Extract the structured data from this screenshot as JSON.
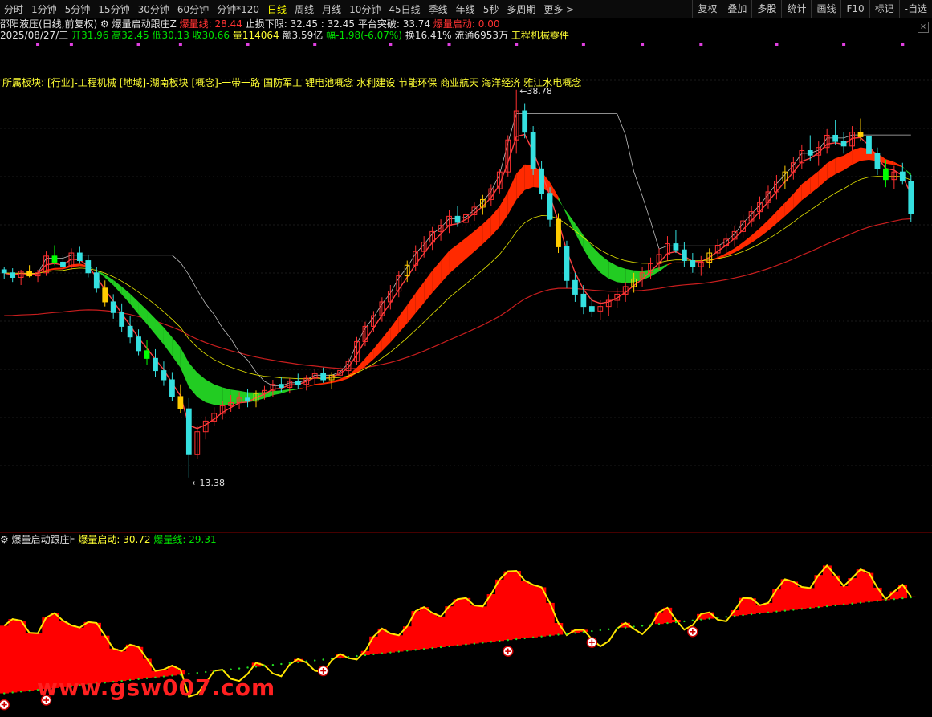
{
  "toolbar": {
    "tabs": [
      "分时",
      "1分钟",
      "5分钟",
      "15分钟",
      "30分钟",
      "60分钟",
      "分钟*120",
      "日线",
      "周线",
      "月线",
      "10分钟",
      "45日线",
      "季线",
      "年线",
      "5秒",
      "多周期",
      "更多 >"
    ],
    "active": "日线",
    "right": [
      "复权",
      "叠加",
      "多股",
      "统计",
      "画线",
      "F10",
      "标记",
      "-自选"
    ]
  },
  "header": {
    "stock_title": "邵阳液压(日线,前复权)",
    "indicator_name": "爆量启动跟庄Z",
    "bl_label": "爆量线:",
    "bl_value": "28.44",
    "stop_label": "止损下限:",
    "stop_value": "32.45",
    "stop_value2": ": 32.45",
    "platform_label": "平台突破:",
    "platform_value": "33.74",
    "launch_label": "爆量启动:",
    "launch_value": "0.00",
    "date": "2025/08/27/三",
    "open_label": "开",
    "open": "31.96",
    "high_label": "高",
    "high": "32.45",
    "low_label": "低",
    "low": "30.13",
    "close_label": "收",
    "close": "30.66",
    "vol_label": "量",
    "vol": "114064",
    "amt_label": "额",
    "amt": "3.59亿",
    "chg_label": "幅",
    "chg": "-1.98(-6.07%)",
    "turnover_label": "换",
    "turnover": "16.41%",
    "float_label": "流通",
    "float": "6953万",
    "industry": "工程机械零件",
    "close_icon": "×"
  },
  "sectors": [
    "所属板块:",
    "[行业]-工程机械",
    "[地域]-湖南板块",
    "[概念]-一带一路",
    "国防军工",
    "锂电池概念",
    "水利建设",
    "节能环保",
    "商业航天",
    "海洋经济",
    "雅江水电概念"
  ],
  "sub": {
    "name": "爆量启动跟庄F",
    "launch_label": "爆量启动:",
    "launch_value": "30.72",
    "bl_label": "爆量线:",
    "bl_value": "29.31"
  },
  "watermark": "www.gsw007.com",
  "chart_data": {
    "type": "candlestick",
    "y_range": [
      10.5,
      41.5
    ],
    "max_label": "38.78",
    "min_label": "13.38",
    "ohlc": [
      [
        27.0,
        27.2,
        26.4,
        26.8
      ],
      [
        26.8,
        27.1,
        26.2,
        26.5
      ],
      [
        26.5,
        27.0,
        26.0,
        26.9
      ],
      [
        26.9,
        27.3,
        26.5,
        26.6
      ],
      [
        26.6,
        27.0,
        26.2,
        26.8
      ],
      [
        26.8,
        28.2,
        26.6,
        27.9
      ],
      [
        27.9,
        28.6,
        27.3,
        27.5
      ],
      [
        27.5,
        28.0,
        26.9,
        27.2
      ],
      [
        27.2,
        28.4,
        27.0,
        28.1
      ],
      [
        28.1,
        28.5,
        27.4,
        27.6
      ],
      [
        27.6,
        28.0,
        26.5,
        26.8
      ],
      [
        26.8,
        27.2,
        25.5,
        25.8
      ],
      [
        25.8,
        26.3,
        24.6,
        24.9
      ],
      [
        24.9,
        25.4,
        23.8,
        24.2
      ],
      [
        24.2,
        24.8,
        22.9,
        23.3
      ],
      [
        23.3,
        24.0,
        22.2,
        22.6
      ],
      [
        22.6,
        23.1,
        21.4,
        21.7
      ],
      [
        21.7,
        22.4,
        20.8,
        21.2
      ],
      [
        21.2,
        21.8,
        20.0,
        20.4
      ],
      [
        20.4,
        21.0,
        19.4,
        19.8
      ],
      [
        19.8,
        20.3,
        18.4,
        18.7
      ],
      [
        18.7,
        19.5,
        17.6,
        17.9
      ],
      [
        17.9,
        18.6,
        13.4,
        14.9
      ],
      [
        14.9,
        16.8,
        14.6,
        16.4
      ],
      [
        16.4,
        17.4,
        15.9,
        17.1
      ],
      [
        17.1,
        18.0,
        16.8,
        17.6
      ],
      [
        17.6,
        18.4,
        17.2,
        18.1
      ],
      [
        18.1,
        18.8,
        17.7,
        18.3
      ],
      [
        18.3,
        19.0,
        17.9,
        18.6
      ],
      [
        18.6,
        19.2,
        18.0,
        18.4
      ],
      [
        18.4,
        19.1,
        18.0,
        18.9
      ],
      [
        18.9,
        19.4,
        18.5,
        19.1
      ],
      [
        19.1,
        19.8,
        18.7,
        19.5
      ],
      [
        19.5,
        20.0,
        19.0,
        19.3
      ],
      [
        19.3,
        19.9,
        18.9,
        19.7
      ],
      [
        19.7,
        20.2,
        19.2,
        19.5
      ],
      [
        19.5,
        20.1,
        19.1,
        19.9
      ],
      [
        19.9,
        20.5,
        19.5,
        20.2
      ],
      [
        20.2,
        20.6,
        19.6,
        19.8
      ],
      [
        19.8,
        20.3,
        19.2,
        20.1
      ],
      [
        20.1,
        20.7,
        19.7,
        20.4
      ],
      [
        20.4,
        21.2,
        20.1,
        21.0
      ],
      [
        21.0,
        22.6,
        20.8,
        22.3
      ],
      [
        22.3,
        23.6,
        22.0,
        23.3
      ],
      [
        23.3,
        24.3,
        22.9,
        24.0
      ],
      [
        24.0,
        25.2,
        23.6,
        24.9
      ],
      [
        24.9,
        26.0,
        24.4,
        25.6
      ],
      [
        25.6,
        26.9,
        25.2,
        26.6
      ],
      [
        26.6,
        27.6,
        26.2,
        27.3
      ],
      [
        27.3,
        28.6,
        26.9,
        28.2
      ],
      [
        28.2,
        29.2,
        27.8,
        28.8
      ],
      [
        28.8,
        29.8,
        28.3,
        29.5
      ],
      [
        29.5,
        30.3,
        28.9,
        29.9
      ],
      [
        29.9,
        30.9,
        29.4,
        30.5
      ],
      [
        30.5,
        31.2,
        29.8,
        30.1
      ],
      [
        30.1,
        30.8,
        29.5,
        30.6
      ],
      [
        30.6,
        31.4,
        30.2,
        31.1
      ],
      [
        31.1,
        31.9,
        30.6,
        31.6
      ],
      [
        31.6,
        32.6,
        31.2,
        32.3
      ],
      [
        32.3,
        33.6,
        32.0,
        33.4
      ],
      [
        33.4,
        35.8,
        33.1,
        35.5
      ],
      [
        35.5,
        38.78,
        34.6,
        37.4
      ],
      [
        37.4,
        37.9,
        35.6,
        36.0
      ],
      [
        36.0,
        36.4,
        33.2,
        33.6
      ],
      [
        33.6,
        34.1,
        31.6,
        32.0
      ],
      [
        32.0,
        32.4,
        29.8,
        30.3
      ],
      [
        30.3,
        30.7,
        28.1,
        28.5
      ],
      [
        28.5,
        28.9,
        25.8,
        26.3
      ],
      [
        26.3,
        26.8,
        24.9,
        25.4
      ],
      [
        25.4,
        26.0,
        24.1,
        24.6
      ],
      [
        24.6,
        25.2,
        23.9,
        24.3
      ],
      [
        24.3,
        25.0,
        23.7,
        24.6
      ],
      [
        24.6,
        25.4,
        24.0,
        25.0
      ],
      [
        25.0,
        25.8,
        24.5,
        25.4
      ],
      [
        25.4,
        26.2,
        24.9,
        25.9
      ],
      [
        25.9,
        26.8,
        25.5,
        26.4
      ],
      [
        26.4,
        27.2,
        25.9,
        26.8
      ],
      [
        26.8,
        27.8,
        26.4,
        27.4
      ],
      [
        27.4,
        28.4,
        27.0,
        28.0
      ],
      [
        28.0,
        29.2,
        27.6,
        28.7
      ],
      [
        28.7,
        29.6,
        28.1,
        28.3
      ],
      [
        28.3,
        28.8,
        27.2,
        27.6
      ],
      [
        27.6,
        28.1,
        26.8,
        27.2
      ],
      [
        27.2,
        27.9,
        26.6,
        27.5
      ],
      [
        27.5,
        28.4,
        27.1,
        28.1
      ],
      [
        28.1,
        29.0,
        27.7,
        28.6
      ],
      [
        28.6,
        29.4,
        28.1,
        29.0
      ],
      [
        29.0,
        29.9,
        28.5,
        29.5
      ],
      [
        29.5,
        30.6,
        29.1,
        30.2
      ],
      [
        30.2,
        31.2,
        29.8,
        30.8
      ],
      [
        30.8,
        31.8,
        30.3,
        31.4
      ],
      [
        31.4,
        32.5,
        31.0,
        32.1
      ],
      [
        32.1,
        33.2,
        31.6,
        32.8
      ],
      [
        32.8,
        33.8,
        32.3,
        33.4
      ],
      [
        33.4,
        34.4,
        32.9,
        34.0
      ],
      [
        34.0,
        35.2,
        33.6,
        34.8
      ],
      [
        34.8,
        35.8,
        34.1,
        34.5
      ],
      [
        34.5,
        35.4,
        33.8,
        35.0
      ],
      [
        35.0,
        36.2,
        34.6,
        35.8
      ],
      [
        35.8,
        36.8,
        35.2,
        35.4
      ],
      [
        35.4,
        36.0,
        34.6,
        35.1
      ],
      [
        35.1,
        36.4,
        34.8,
        36.0
      ],
      [
        36.0,
        36.9,
        35.4,
        35.7
      ],
      [
        35.7,
        36.3,
        34.2,
        34.6
      ],
      [
        34.6,
        35.0,
        33.2,
        33.6
      ],
      [
        33.6,
        34.2,
        32.4,
        32.9
      ],
      [
        32.9,
        33.8,
        32.3,
        33.4
      ],
      [
        33.4,
        34.0,
        32.6,
        32.8
      ],
      [
        32.8,
        33.2,
        30.1,
        30.66
      ]
    ]
  }
}
